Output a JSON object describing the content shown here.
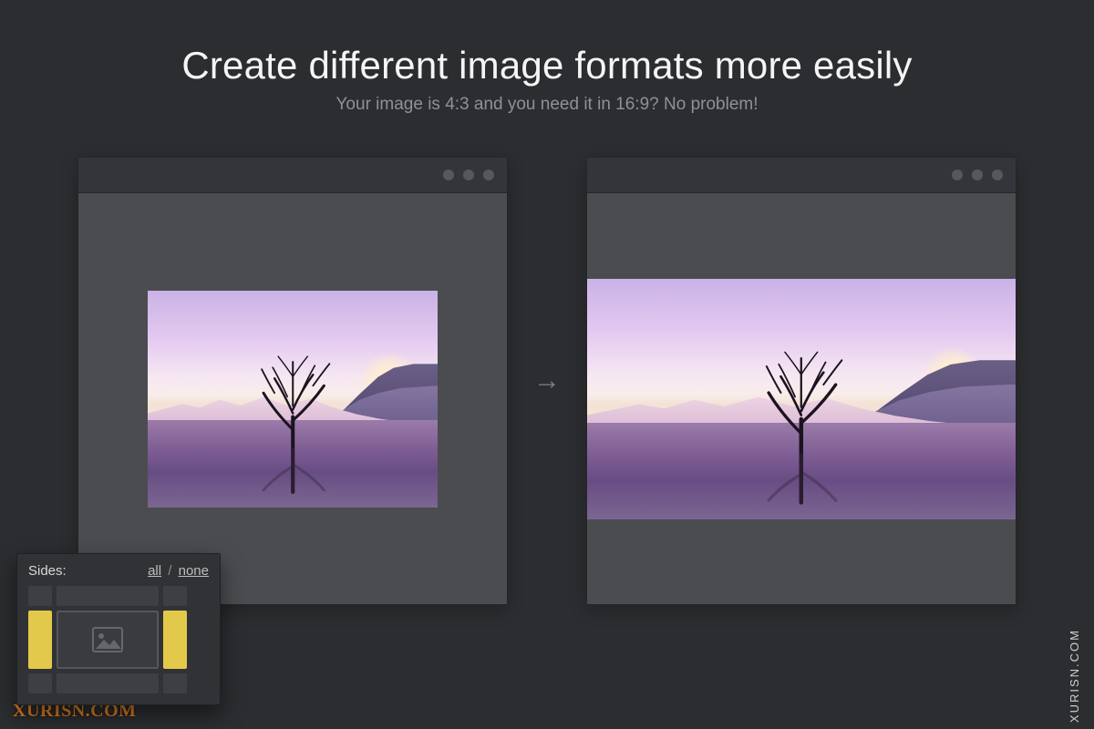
{
  "headline": {
    "title": "Create different image formats more easily",
    "subtitle": "Your image is 4:3 and you need it in 16:9? No problem!"
  },
  "arrow_glyph": "→",
  "sides_panel": {
    "label": "Sides:",
    "link_all": "all",
    "separator": "/",
    "link_none": "none",
    "selection": {
      "top": false,
      "bottom": false,
      "left": true,
      "right": true,
      "tl": false,
      "tr": false,
      "bl": false,
      "br": false
    }
  },
  "watermark": {
    "side": "XURISN.COM",
    "corner": "XURISN.COM"
  }
}
